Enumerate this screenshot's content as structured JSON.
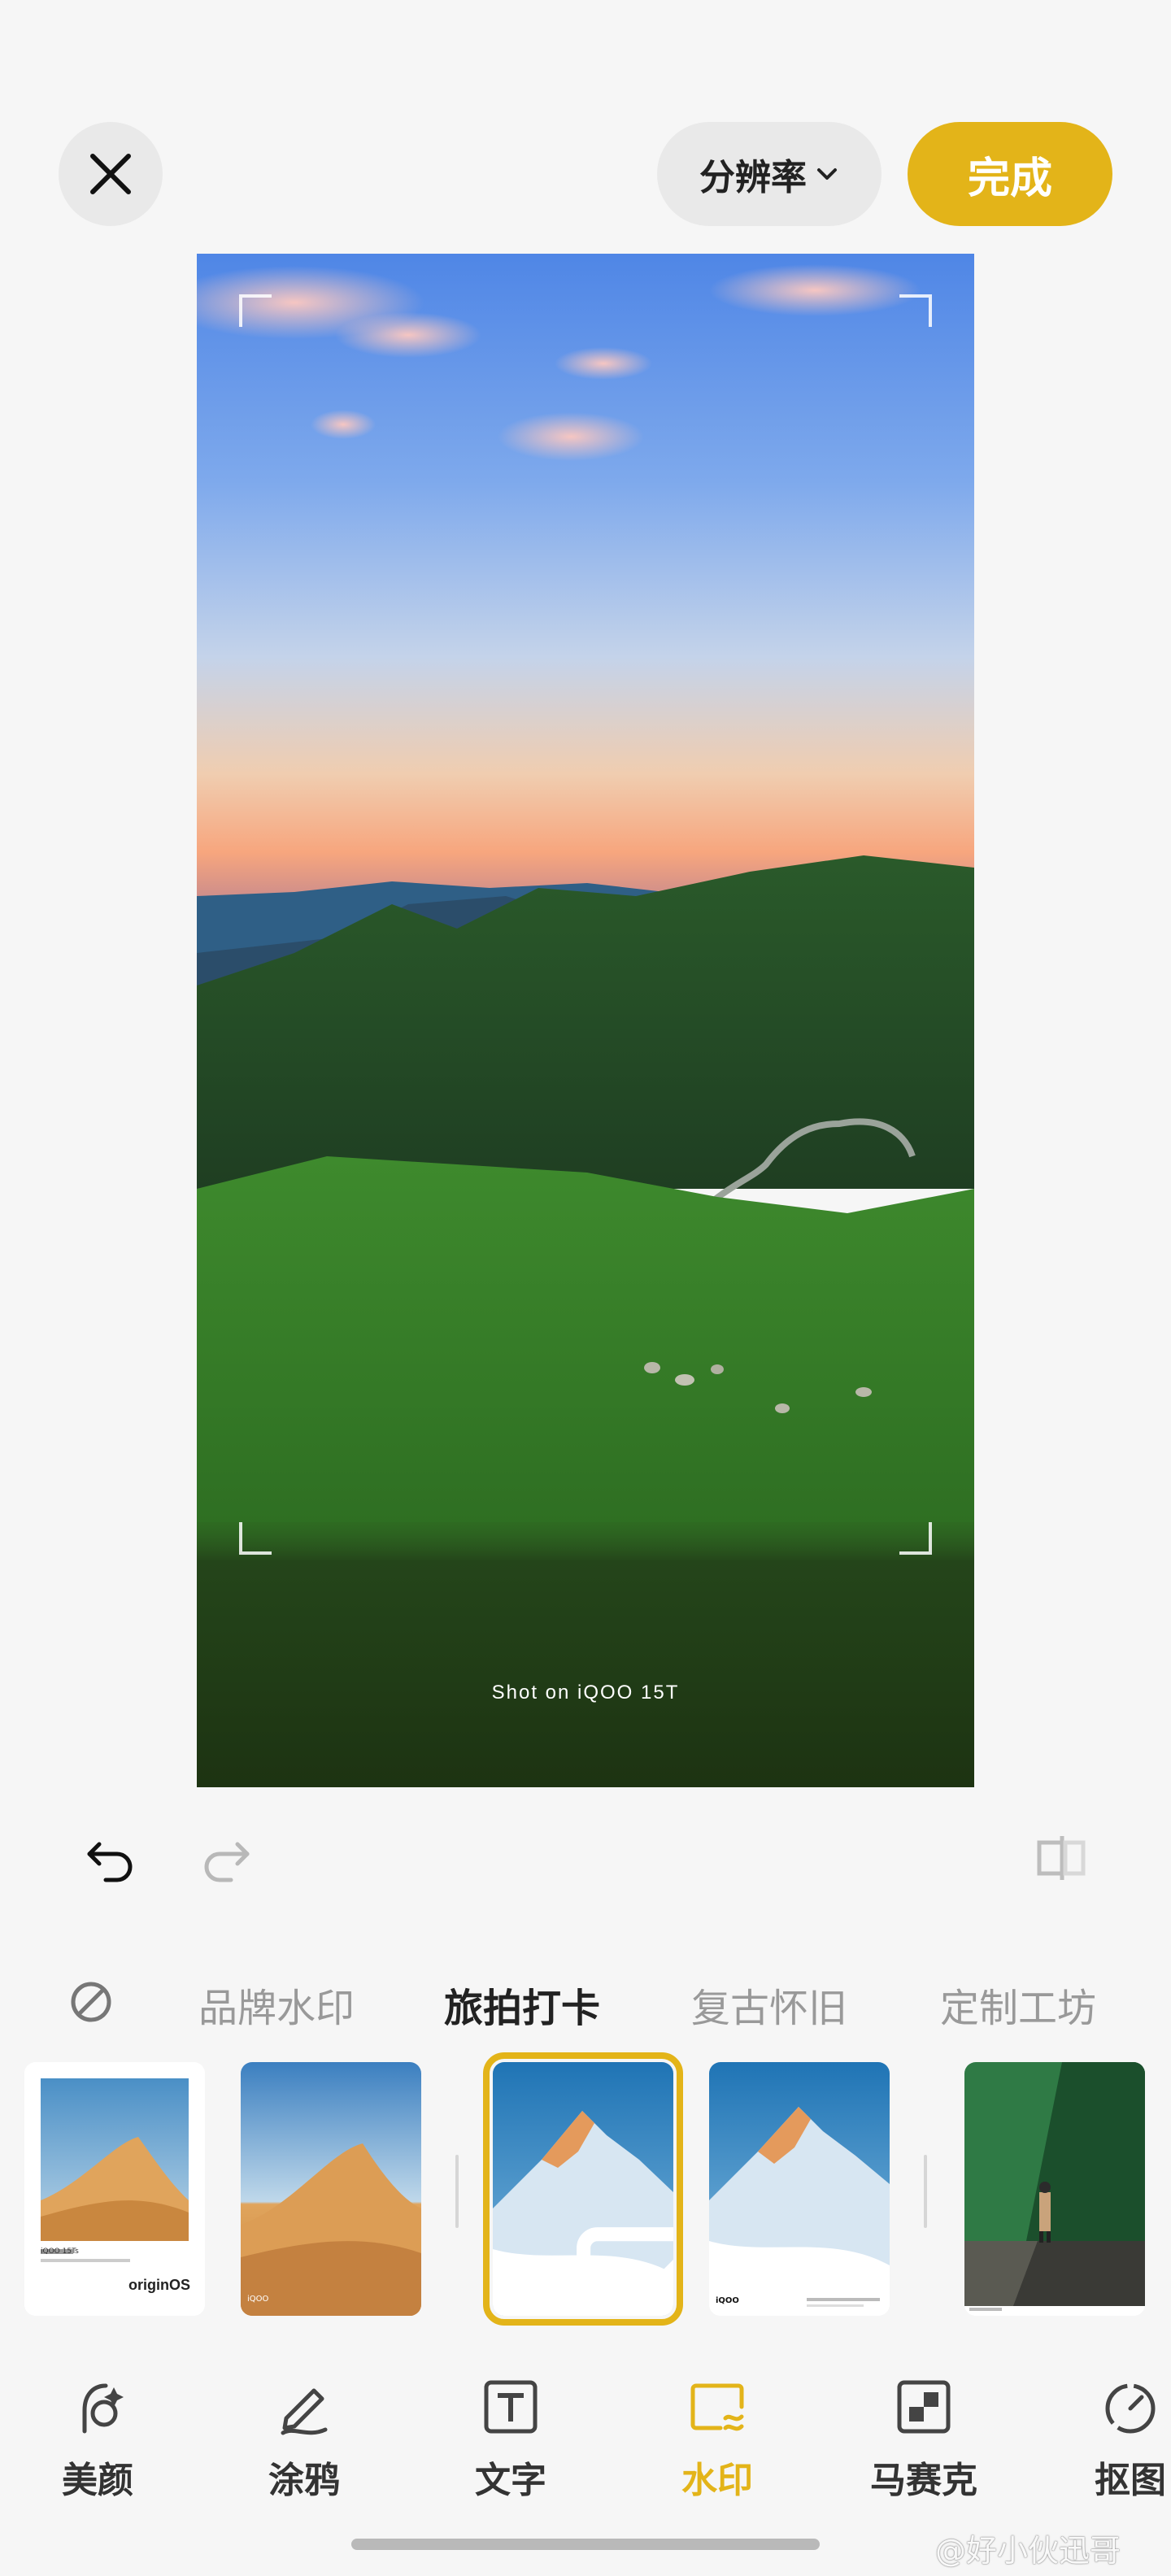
{
  "header": {
    "resolution_label": "分辨率",
    "done_label": "完成"
  },
  "photo": {
    "watermark_text": "Shot on iQOO 15T"
  },
  "watermark_tabs": [
    {
      "label": "品牌水印",
      "active": false
    },
    {
      "label": "旅拍打卡",
      "active": true
    },
    {
      "label": "复古怀旧",
      "active": false
    },
    {
      "label": "定制工坊",
      "active": false
    }
  ],
  "thumbnails": {
    "t1_caption": "originOS",
    "t1_meta": "iQOO 15Ts",
    "t2_caption": "iQOO",
    "t4_caption": "iQOO",
    "selected_index": 2
  },
  "bottom_nav": [
    {
      "label": "美颜",
      "icon": "face-beauty-icon",
      "active": false
    },
    {
      "label": "涂鸦",
      "icon": "pen-icon",
      "active": false
    },
    {
      "label": "文字",
      "icon": "text-icon",
      "active": false
    },
    {
      "label": "水印",
      "icon": "watermark-icon",
      "active": true
    },
    {
      "label": "马赛克",
      "icon": "mosaic-icon",
      "active": false
    },
    {
      "label": "抠图",
      "icon": "cutout-icon",
      "active": false
    }
  ],
  "credit": "@好小伙迅哥",
  "colors": {
    "accent": "#e3b419",
    "background": "#f6f6f6"
  }
}
